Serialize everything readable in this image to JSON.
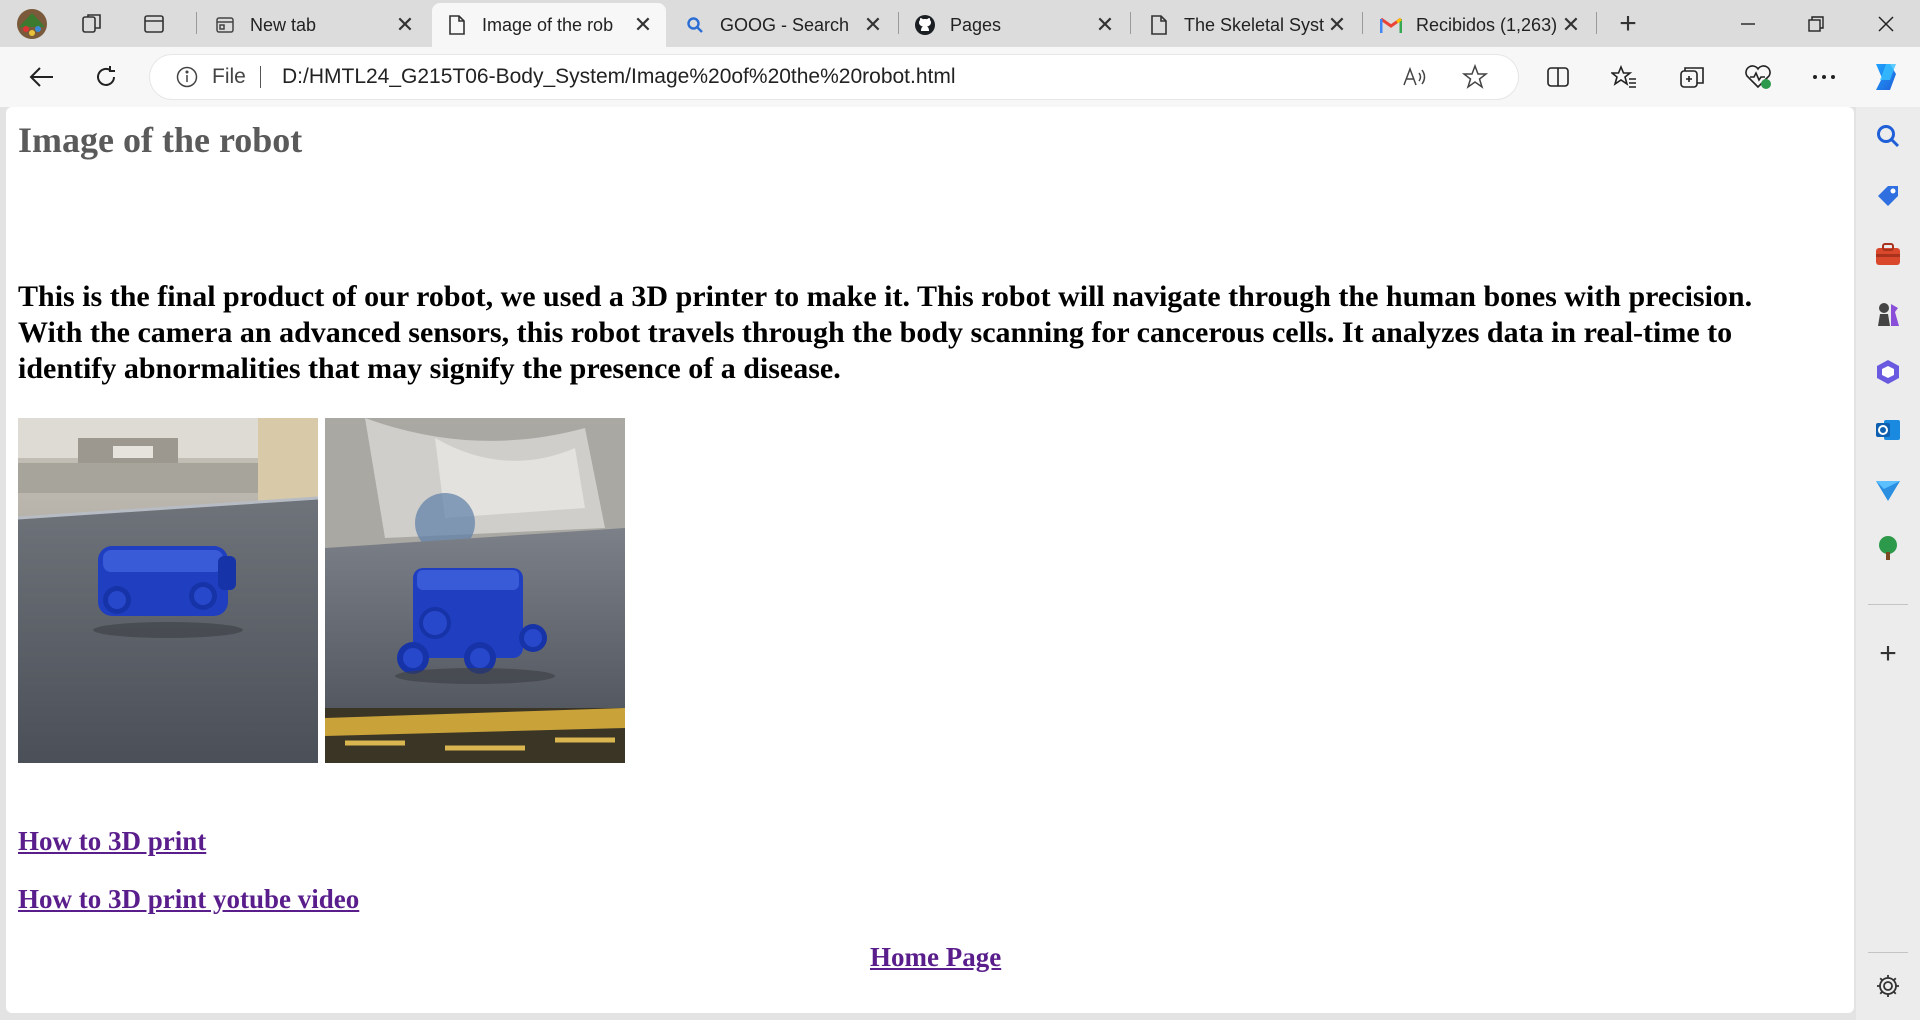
{
  "browser": {
    "tabs": [
      {
        "title": "New tab",
        "icon": "newtab-icon"
      },
      {
        "title": "Image of the rob",
        "icon": "document-icon",
        "active": true
      },
      {
        "title": "GOOG - Search",
        "icon": "search-icon"
      },
      {
        "title": "Pages",
        "icon": "github-icon"
      },
      {
        "title": "The Skeletal Syst",
        "icon": "document-icon"
      },
      {
        "title": "Recibidos (1,263)",
        "icon": "gmail-icon"
      }
    ],
    "address": {
      "scheme_label": "File",
      "url": "D:/HMTL24_G215T06-Body_System/Image%20of%20the%20robot.html"
    }
  },
  "page": {
    "title": "Image of the robot",
    "description": "This is the final product of our robot, we used a 3D printer to make it. This robot will navigate through the human bones with precision. With the camera an advanced sensors, this robot travels through the body scanning for cancerous cells. It analyzes data in real-time to identify abnormalities that may signify the presence of a disease.",
    "links": {
      "how_to_print": "How to 3D print",
      "how_to_print_video": "How to 3D print yotube video",
      "home": "Home Page"
    }
  },
  "colors": {
    "link": "#5a1e8c",
    "title": "#5a5a5a",
    "robot_blue": "#1f3fc0"
  }
}
